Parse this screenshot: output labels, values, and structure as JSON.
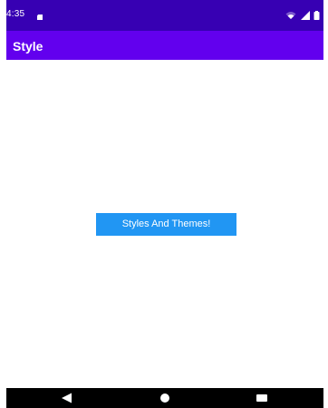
{
  "status_bar": {
    "time": "4:35",
    "sim_icon": "sim-card-icon",
    "wifi_icon": "wifi-icon",
    "signal_icon": "cell-signal-icon",
    "battery_icon": "battery-icon"
  },
  "app_bar": {
    "title": "Style"
  },
  "main": {
    "button_label": "Styles And Themes!"
  },
  "nav_bar": {
    "back_icon": "back-triangle-icon",
    "home_icon": "home-circle-icon",
    "recents_icon": "recents-square-icon"
  },
  "colors": {
    "status_bar": "#3700b3",
    "app_bar": "#6200ee",
    "button": "#2196f3",
    "nav_bar": "#000000"
  }
}
